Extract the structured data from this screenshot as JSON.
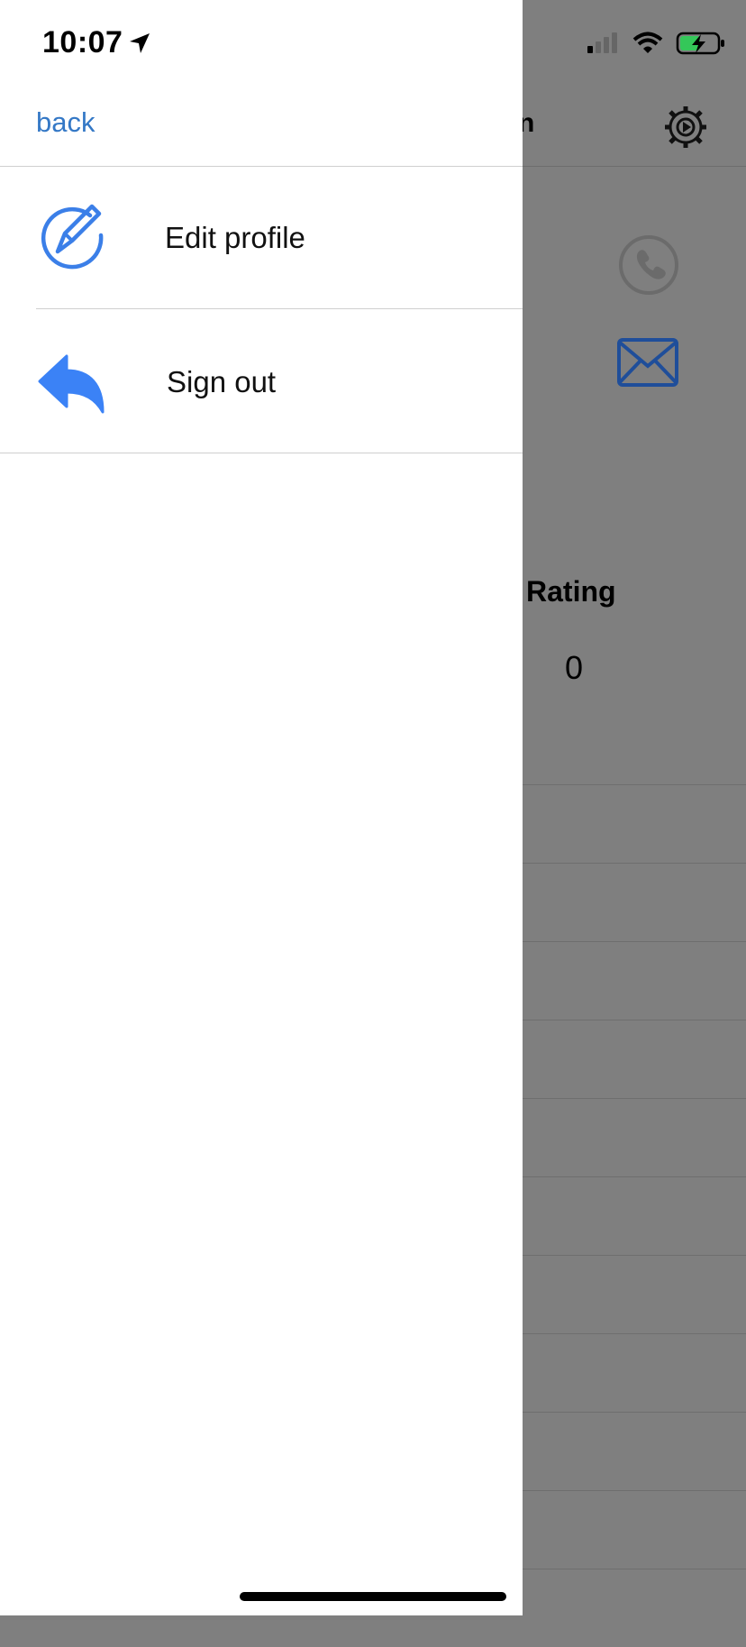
{
  "status_bar": {
    "time": "10:07"
  },
  "drawer": {
    "back_label": "back",
    "items": [
      {
        "label": "Edit profile",
        "icon": "edit-circle-icon"
      },
      {
        "label": "Sign out",
        "icon": "reply-arrow-icon"
      }
    ]
  },
  "background": {
    "title_fragment": "n",
    "rating_label": "Rating",
    "rating_value": "0"
  },
  "colors": {
    "accent": "#3478c6",
    "icon_blue": "#3b82f6",
    "overlay": "#7f7f7f"
  }
}
